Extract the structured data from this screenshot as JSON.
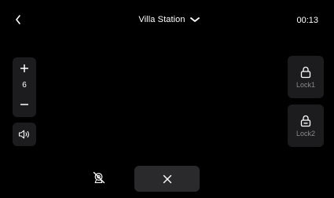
{
  "header": {
    "back_icon": "chevron-left-icon",
    "title": "Villa Station",
    "dropdown_icon": "chevron-down-icon",
    "time": "00:13"
  },
  "volume": {
    "plus_icon": "plus-icon",
    "value": "6",
    "minus_icon": "minus-icon",
    "speaker_icon": "speaker-icon"
  },
  "locks": [
    {
      "label": "Lock1",
      "icon": "lock-icon"
    },
    {
      "label": "Lock2",
      "icon": "lock-keyhole-icon"
    }
  ],
  "controls": {
    "camera_off_icon": "camera-off-icon",
    "hangup_icon": "close-icon"
  },
  "colors": {
    "background": "#000000",
    "panel": "#1c1c1e",
    "hangup_bg": "#2a2a2d",
    "text": "#ffffff",
    "muted_text": "#8a8a8e"
  }
}
